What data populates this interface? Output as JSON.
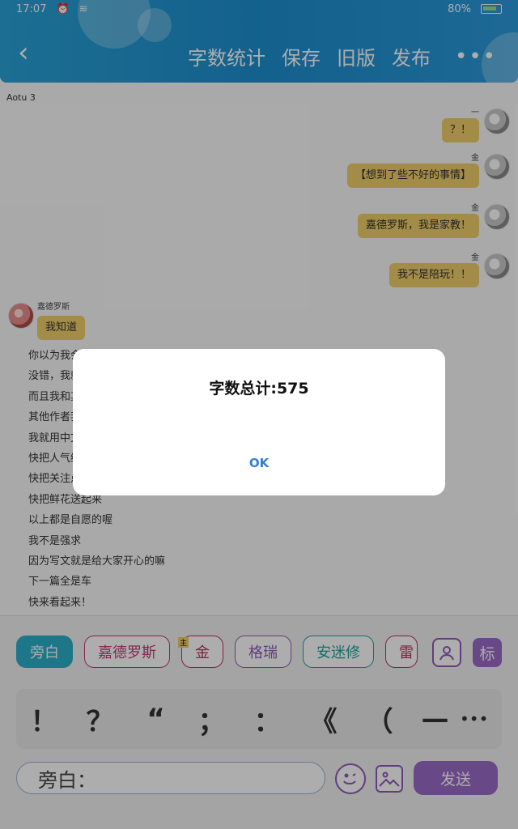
{
  "status_bar": {
    "time": "17:07",
    "battery": "80%"
  },
  "header": {
    "back_icon": "chevron-left-icon",
    "actions": [
      "字数统计",
      "保存",
      "旧版",
      "发布"
    ],
    "more_label": "•••"
  },
  "author": "Aotu 3",
  "messages_right": [
    {
      "name": "一",
      "text": "？！"
    },
    {
      "name": "金",
      "text": "【想到了些不好的事情】"
    },
    {
      "name": "金",
      "text": "嘉德罗斯，我是家教！"
    },
    {
      "name": "金",
      "text": "我不是陪玩！！"
    }
  ],
  "message_left": {
    "name": "嘉德罗斯",
    "text": "我知道"
  },
  "narration": [
    "你以为我会",
    "没错，我就",
    "而且我和其",
    "其他作者我",
    "我就用中文",
    "快把人气给",
    "快把关注点",
    "快把鲜花送起来",
    "以上都是自愿的喔",
    "我不是强求",
    "因为写文就是给大家开心的嘛",
    "下一篇全是车",
    "快来看起来！"
  ],
  "dialog": {
    "title": "字数总计:575",
    "ok_label": "OK"
  },
  "characters": [
    {
      "label": "旁白"
    },
    {
      "label": "嘉德罗斯"
    },
    {
      "label": "金"
    },
    {
      "label": "格瑞"
    },
    {
      "label": "安迷修"
    },
    {
      "label": "雷"
    }
  ],
  "character_badge": "主",
  "biao_label": "标",
  "punctuation": [
    "！",
    "？",
    "“",
    "；",
    "：",
    "《",
    "（",
    "—"
  ],
  "punct_more": "•••",
  "input": {
    "placeholder": "旁白："
  },
  "send_label": "发送"
}
